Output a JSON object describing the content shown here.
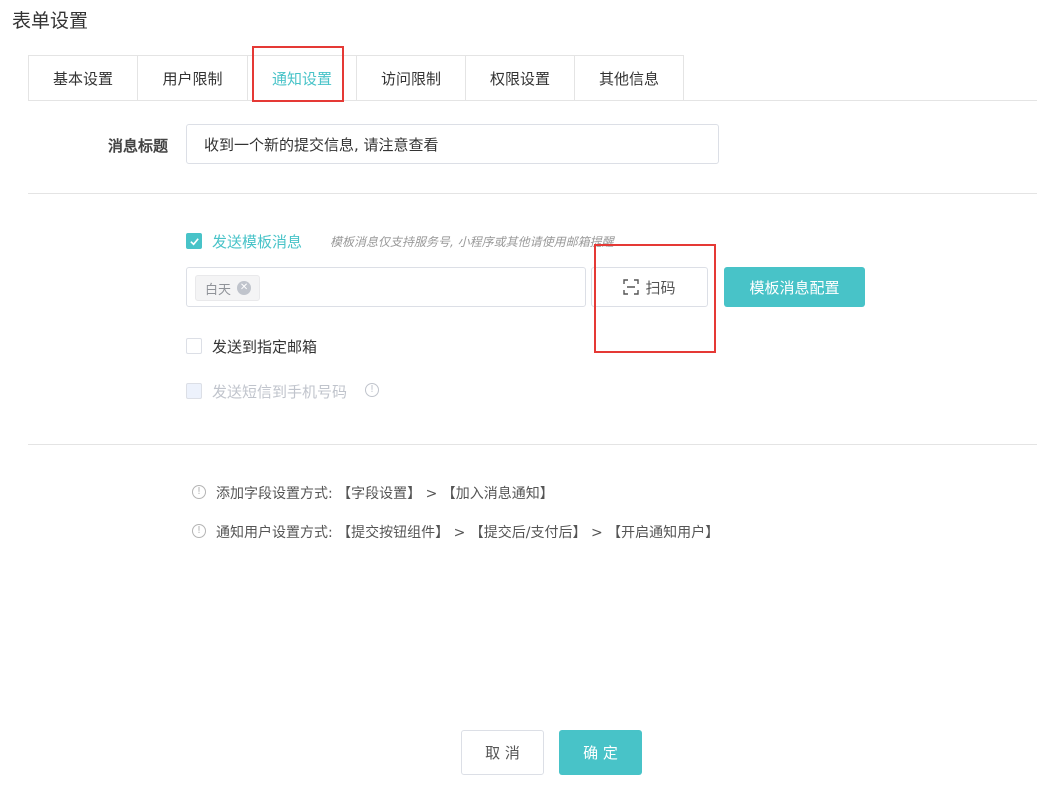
{
  "page": {
    "title": "表单设置"
  },
  "tabs": [
    {
      "label": "基本设置"
    },
    {
      "label": "用户限制"
    },
    {
      "label": "通知设置",
      "active": true
    },
    {
      "label": "访问限制"
    },
    {
      "label": "权限设置"
    },
    {
      "label": "其他信息"
    }
  ],
  "message_title": {
    "label": "消息标题",
    "value": "收到一个新的提交信息, 请注意查看"
  },
  "template_message": {
    "checked": true,
    "label": "发送模板消息",
    "hint": "模板消息仅支持服务号, 小程序或其他请使用邮箱提醒",
    "tags": [
      "白天"
    ],
    "scan_label": "扫码",
    "config_label": "模板消息配置"
  },
  "email": {
    "checked": false,
    "label": "发送到指定邮箱"
  },
  "sms": {
    "checked": false,
    "disabled": true,
    "label": "发送短信到手机号码"
  },
  "info": [
    {
      "text": "添加字段设置方式: 【字段设置】 > 【加入消息通知】"
    },
    {
      "text": "通知用户设置方式: 【提交按钮组件】 > 【提交后/支付后】 > 【开启通知用户】"
    }
  ],
  "footer": {
    "cancel_label": "取 消",
    "confirm_label": "确 定"
  },
  "colors": {
    "accent": "#48c3c8",
    "highlight": "#e53935"
  }
}
